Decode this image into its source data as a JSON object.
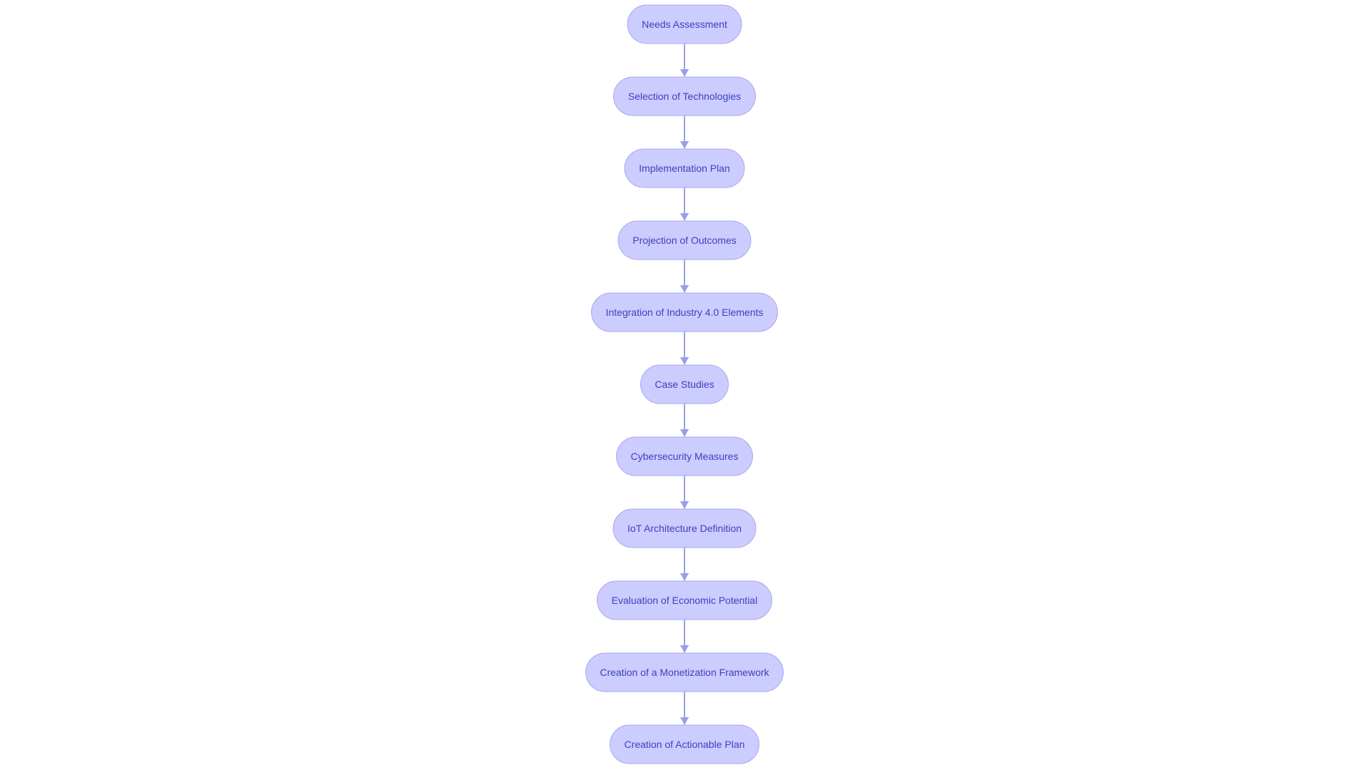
{
  "diagram": {
    "type": "flowchart",
    "direction": "top-to-bottom",
    "colors": {
      "node_fill": "#ccccff",
      "node_border": "#a7a8ee",
      "node_text": "#3c3fbf",
      "edge": "#9a9ee6",
      "background": "#ffffff"
    },
    "nodes": [
      {
        "id": "n1",
        "label": "Needs Assessment"
      },
      {
        "id": "n2",
        "label": "Selection of Technologies"
      },
      {
        "id": "n3",
        "label": "Implementation Plan"
      },
      {
        "id": "n4",
        "label": "Projection of Outcomes"
      },
      {
        "id": "n5",
        "label": "Integration of Industry 4.0 Elements"
      },
      {
        "id": "n6",
        "label": "Case Studies"
      },
      {
        "id": "n7",
        "label": "Cybersecurity Measures"
      },
      {
        "id": "n8",
        "label": "IoT Architecture Definition"
      },
      {
        "id": "n9",
        "label": "Evaluation of Economic Potential"
      },
      {
        "id": "n10",
        "label": "Creation of a Monetization Framework"
      },
      {
        "id": "n11",
        "label": "Creation of Actionable Plan"
      }
    ],
    "edges": [
      {
        "from": "n1",
        "to": "n2"
      },
      {
        "from": "n2",
        "to": "n3"
      },
      {
        "from": "n3",
        "to": "n4"
      },
      {
        "from": "n4",
        "to": "n5"
      },
      {
        "from": "n5",
        "to": "n6"
      },
      {
        "from": "n6",
        "to": "n7"
      },
      {
        "from": "n7",
        "to": "n8"
      },
      {
        "from": "n8",
        "to": "n9"
      },
      {
        "from": "n9",
        "to": "n10"
      },
      {
        "from": "n10",
        "to": "n11"
      }
    ]
  }
}
